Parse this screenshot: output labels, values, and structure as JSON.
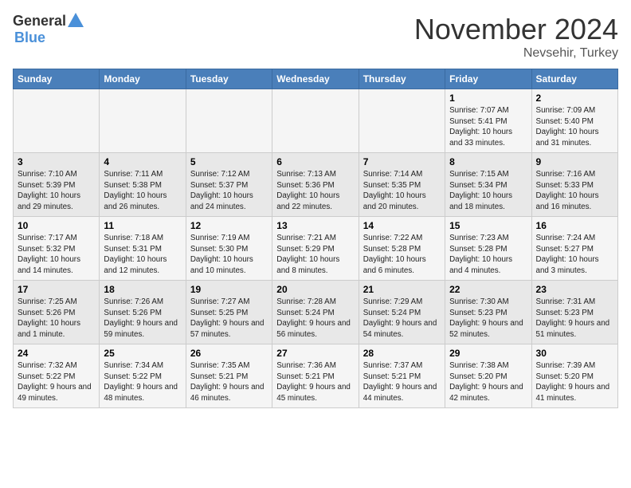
{
  "header": {
    "logo_general": "General",
    "logo_blue": "Blue",
    "month": "November 2024",
    "location": "Nevsehir, Turkey"
  },
  "weekdays": [
    "Sunday",
    "Monday",
    "Tuesday",
    "Wednesday",
    "Thursday",
    "Friday",
    "Saturday"
  ],
  "weeks": [
    [
      {
        "day": "",
        "info": ""
      },
      {
        "day": "",
        "info": ""
      },
      {
        "day": "",
        "info": ""
      },
      {
        "day": "",
        "info": ""
      },
      {
        "day": "",
        "info": ""
      },
      {
        "day": "1",
        "info": "Sunrise: 7:07 AM\nSunset: 5:41 PM\nDaylight: 10 hours and 33 minutes."
      },
      {
        "day": "2",
        "info": "Sunrise: 7:09 AM\nSunset: 5:40 PM\nDaylight: 10 hours and 31 minutes."
      }
    ],
    [
      {
        "day": "3",
        "info": "Sunrise: 7:10 AM\nSunset: 5:39 PM\nDaylight: 10 hours and 29 minutes."
      },
      {
        "day": "4",
        "info": "Sunrise: 7:11 AM\nSunset: 5:38 PM\nDaylight: 10 hours and 26 minutes."
      },
      {
        "day": "5",
        "info": "Sunrise: 7:12 AM\nSunset: 5:37 PM\nDaylight: 10 hours and 24 minutes."
      },
      {
        "day": "6",
        "info": "Sunrise: 7:13 AM\nSunset: 5:36 PM\nDaylight: 10 hours and 22 minutes."
      },
      {
        "day": "7",
        "info": "Sunrise: 7:14 AM\nSunset: 5:35 PM\nDaylight: 10 hours and 20 minutes."
      },
      {
        "day": "8",
        "info": "Sunrise: 7:15 AM\nSunset: 5:34 PM\nDaylight: 10 hours and 18 minutes."
      },
      {
        "day": "9",
        "info": "Sunrise: 7:16 AM\nSunset: 5:33 PM\nDaylight: 10 hours and 16 minutes."
      }
    ],
    [
      {
        "day": "10",
        "info": "Sunrise: 7:17 AM\nSunset: 5:32 PM\nDaylight: 10 hours and 14 minutes."
      },
      {
        "day": "11",
        "info": "Sunrise: 7:18 AM\nSunset: 5:31 PM\nDaylight: 10 hours and 12 minutes."
      },
      {
        "day": "12",
        "info": "Sunrise: 7:19 AM\nSunset: 5:30 PM\nDaylight: 10 hours and 10 minutes."
      },
      {
        "day": "13",
        "info": "Sunrise: 7:21 AM\nSunset: 5:29 PM\nDaylight: 10 hours and 8 minutes."
      },
      {
        "day": "14",
        "info": "Sunrise: 7:22 AM\nSunset: 5:28 PM\nDaylight: 10 hours and 6 minutes."
      },
      {
        "day": "15",
        "info": "Sunrise: 7:23 AM\nSunset: 5:28 PM\nDaylight: 10 hours and 4 minutes."
      },
      {
        "day": "16",
        "info": "Sunrise: 7:24 AM\nSunset: 5:27 PM\nDaylight: 10 hours and 3 minutes."
      }
    ],
    [
      {
        "day": "17",
        "info": "Sunrise: 7:25 AM\nSunset: 5:26 PM\nDaylight: 10 hours and 1 minute."
      },
      {
        "day": "18",
        "info": "Sunrise: 7:26 AM\nSunset: 5:26 PM\nDaylight: 9 hours and 59 minutes."
      },
      {
        "day": "19",
        "info": "Sunrise: 7:27 AM\nSunset: 5:25 PM\nDaylight: 9 hours and 57 minutes."
      },
      {
        "day": "20",
        "info": "Sunrise: 7:28 AM\nSunset: 5:24 PM\nDaylight: 9 hours and 56 minutes."
      },
      {
        "day": "21",
        "info": "Sunrise: 7:29 AM\nSunset: 5:24 PM\nDaylight: 9 hours and 54 minutes."
      },
      {
        "day": "22",
        "info": "Sunrise: 7:30 AM\nSunset: 5:23 PM\nDaylight: 9 hours and 52 minutes."
      },
      {
        "day": "23",
        "info": "Sunrise: 7:31 AM\nSunset: 5:23 PM\nDaylight: 9 hours and 51 minutes."
      }
    ],
    [
      {
        "day": "24",
        "info": "Sunrise: 7:32 AM\nSunset: 5:22 PM\nDaylight: 9 hours and 49 minutes."
      },
      {
        "day": "25",
        "info": "Sunrise: 7:34 AM\nSunset: 5:22 PM\nDaylight: 9 hours and 48 minutes."
      },
      {
        "day": "26",
        "info": "Sunrise: 7:35 AM\nSunset: 5:21 PM\nDaylight: 9 hours and 46 minutes."
      },
      {
        "day": "27",
        "info": "Sunrise: 7:36 AM\nSunset: 5:21 PM\nDaylight: 9 hours and 45 minutes."
      },
      {
        "day": "28",
        "info": "Sunrise: 7:37 AM\nSunset: 5:21 PM\nDaylight: 9 hours and 44 minutes."
      },
      {
        "day": "29",
        "info": "Sunrise: 7:38 AM\nSunset: 5:20 PM\nDaylight: 9 hours and 42 minutes."
      },
      {
        "day": "30",
        "info": "Sunrise: 7:39 AM\nSunset: 5:20 PM\nDaylight: 9 hours and 41 minutes."
      }
    ]
  ]
}
